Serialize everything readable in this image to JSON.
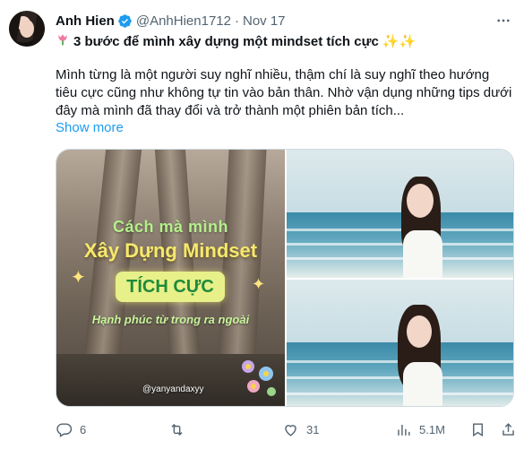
{
  "author": {
    "name": "Anh Hien",
    "handle": "@AnhHien1712",
    "separator": "·",
    "date": "Nov 17",
    "verified_color": "#1d9bf0"
  },
  "tweet": {
    "title_prefix_icon": "tulip-emoji",
    "title": "3 bước để mình xây dựng một mindset tích cực",
    "title_suffix": "✨✨",
    "body": "Mình từng là một người suy nghĩ nhiều, thậm chí là suy nghĩ theo hướng tiêu cực cũng như không tự tin vào bản thân. Nhờ vận dụng những tips dưới đây mà mình đã thay đổi và trở thành một phiên bản tích...",
    "show_more": "Show more"
  },
  "media": {
    "left_image": {
      "line1": "Cách mà mình",
      "line2": "Xây Dựng Mindset",
      "line3": "TÍCH CỰC",
      "line4": "Hạnh phúc từ trong ra ngoài",
      "watermark": "@yanyandaxyy"
    },
    "right_top_image": "beach-portrait",
    "right_bottom_image": "beach-portrait"
  },
  "actions": {
    "reply_count": "6",
    "retweet_count": "",
    "like_count": "31",
    "views_count": "5.1M"
  },
  "colors": {
    "link": "#1d9bf0",
    "muted": "#536471",
    "text": "#0f1419"
  }
}
